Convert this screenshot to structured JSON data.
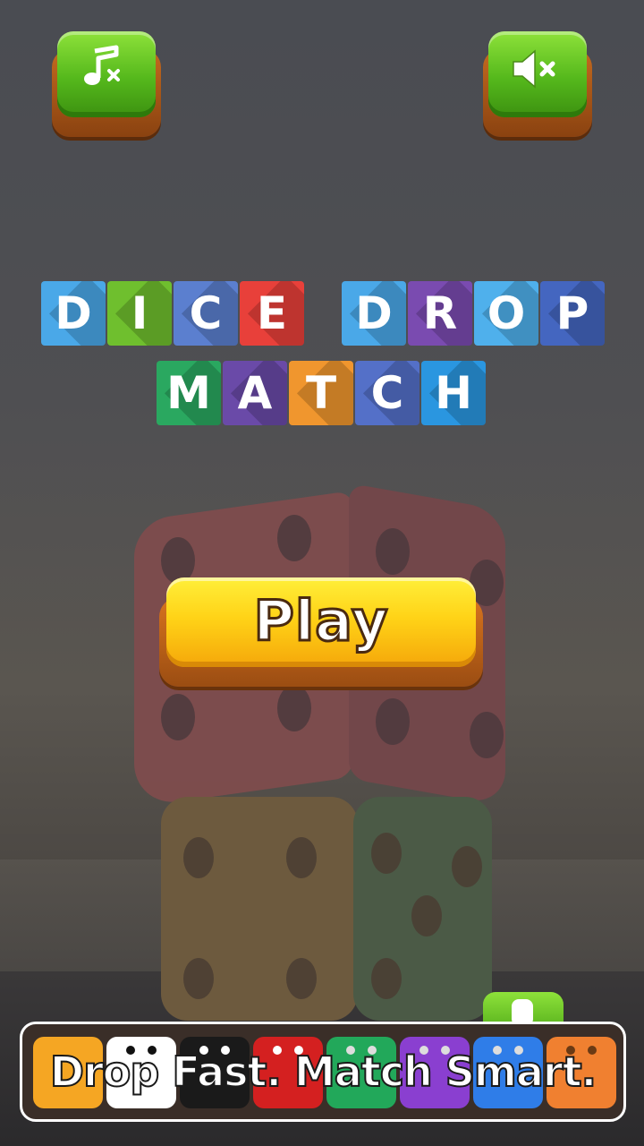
{
  "title": {
    "row1": [
      {
        "letter": "D",
        "color": "#4aa8e8"
      },
      {
        "letter": "I",
        "color": "#6fbf2e"
      },
      {
        "letter": "C",
        "color": "#5b7fcf"
      },
      {
        "letter": "E",
        "color": "#e8403a"
      },
      {
        "letter": "D",
        "color": "#4aa8e8"
      },
      {
        "letter": "R",
        "color": "#7a4bb0"
      },
      {
        "letter": "O",
        "color": "#4fb0ec"
      },
      {
        "letter": "P",
        "color": "#4466c0"
      }
    ],
    "row2": [
      {
        "letter": "M",
        "color": "#2aa860"
      },
      {
        "letter": "A",
        "color": "#6a4aa8"
      },
      {
        "letter": "T",
        "color": "#f0962e"
      },
      {
        "letter": "C",
        "color": "#5470c8"
      },
      {
        "letter": "H",
        "color": "#2a96e0"
      }
    ]
  },
  "buttons": {
    "music": {
      "icon": "music-off-icon"
    },
    "sound": {
      "icon": "sound-off-icon"
    },
    "play": {
      "label": "Play"
    }
  },
  "banner": {
    "text": "Drop Fast. Match Smart.",
    "dice_colors": [
      "#f5a623",
      "#ffffff",
      "#1a1a1a",
      "#d42020",
      "#22a85a",
      "#8a3fd0",
      "#2f7de8",
      "#f08030"
    ]
  }
}
